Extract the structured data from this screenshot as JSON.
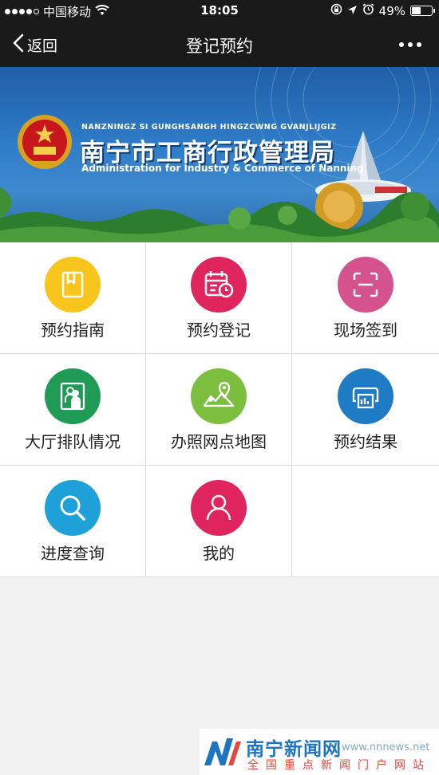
{
  "status_bar": {
    "carrier": "中国移动",
    "time": "18:05",
    "battery": "49%",
    "battery_level": 0.49
  },
  "nav": {
    "back_label": "返回",
    "title": "登记预约"
  },
  "banner": {
    "pinyin": "NANZNINGZ SI GUNGHSANGH HINGZCWNG GVANJLIJGIZ",
    "title": "南宁市工商行政管理局",
    "subtitle": "Administration for Industry & Commerce of Nanning"
  },
  "grid": {
    "items": [
      {
        "label": "预约指南",
        "icon": "book-icon",
        "color": "#f7c51c"
      },
      {
        "label": "预约登记",
        "icon": "calendar-clock-icon",
        "color": "#e0245e"
      },
      {
        "label": "现场签到",
        "icon": "scan-icon",
        "color": "#d4538f"
      },
      {
        "label": "大厅排队情况",
        "icon": "queue-people-icon",
        "color": "#1f9b56"
      },
      {
        "label": "办照网点地图",
        "icon": "map-pin-icon",
        "color": "#7cbf3f"
      },
      {
        "label": "预约结果",
        "icon": "printer-icon",
        "color": "#1e7bc4"
      },
      {
        "label": "进度查询",
        "icon": "search-icon",
        "color": "#1ea1d8"
      },
      {
        "label": "我的",
        "icon": "user-icon",
        "color": "#e0245e"
      }
    ]
  },
  "watermark": {
    "name": "南宁新闻网",
    "url": "www.nnnews.net",
    "slogan": "全国重点新闻门户网站"
  }
}
